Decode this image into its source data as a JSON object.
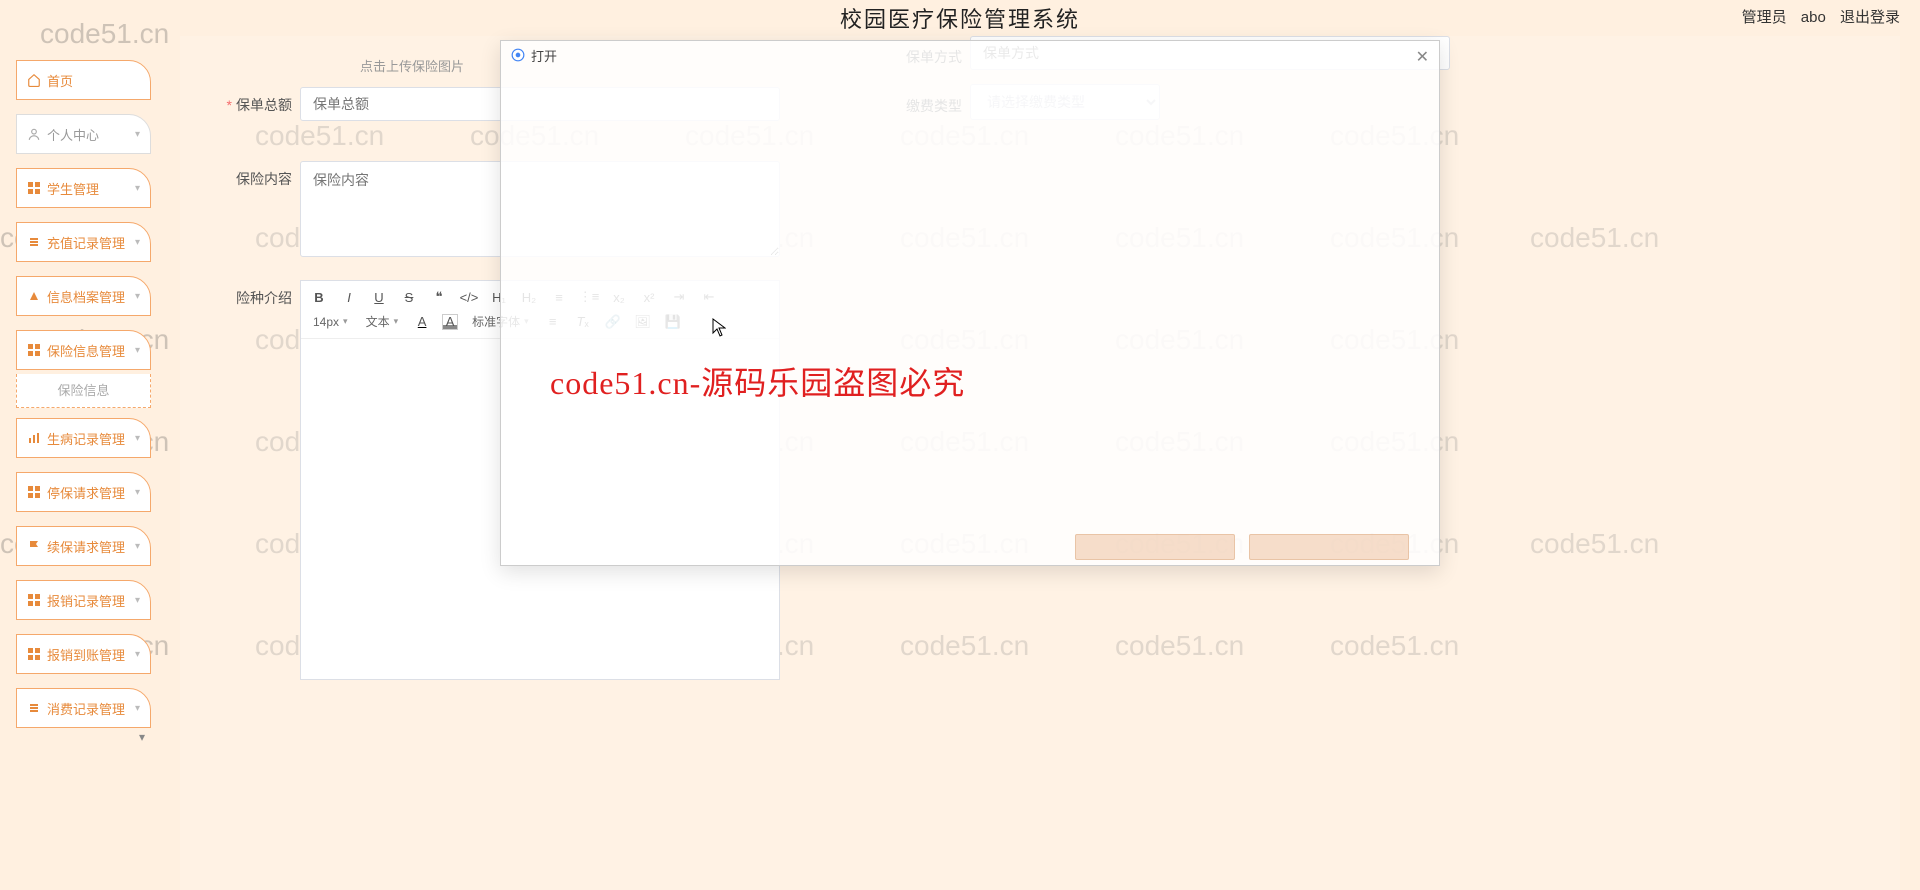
{
  "header": {
    "title": "校园医疗保险管理系统",
    "role": "管理员",
    "user": "abo",
    "logout": "退出登录"
  },
  "sidebar": {
    "items": [
      {
        "label": "首页",
        "icon": "home-icon"
      },
      {
        "label": "个人中心",
        "icon": "user-icon",
        "expandable": true
      },
      {
        "label": "学生管理",
        "icon": "grid-icon",
        "expandable": true
      },
      {
        "label": "充值记录管理",
        "icon": "list-icon",
        "expandable": true
      },
      {
        "label": "信息档案管理",
        "icon": "triangle-icon",
        "expandable": true
      },
      {
        "label": "保险信息管理",
        "icon": "grid-icon",
        "expandable": true,
        "sub": "保险信息"
      },
      {
        "label": "生病记录管理",
        "icon": "chart-icon",
        "expandable": true
      },
      {
        "label": "停保请求管理",
        "icon": "grid-icon",
        "expandable": true
      },
      {
        "label": "续保请求管理",
        "icon": "flag-icon",
        "expandable": true
      },
      {
        "label": "报销记录管理",
        "icon": "grid-icon",
        "expandable": true
      },
      {
        "label": "报销到账管理",
        "icon": "grid-icon",
        "expandable": true
      },
      {
        "label": "消费记录管理",
        "icon": "list-icon",
        "expandable": true
      }
    ]
  },
  "form": {
    "upload_hint": "点击上传保险图片",
    "amount_label": "保单总额",
    "amount_placeholder": "保单总额",
    "method_label": "保单方式",
    "method_placeholder": "保单方式",
    "paytype_label": "缴费类型",
    "paytype_placeholder": "请选择缴费类型",
    "content_label": "保险内容",
    "content_placeholder": "保险内容",
    "intro_label": "险种介绍"
  },
  "editor": {
    "fontsize": "14px",
    "textlabel": "文本",
    "fontlabel": "标准字体"
  },
  "dialog": {
    "title": "打开"
  },
  "overlay_text": "code51.cn-源码乐园盗图必究",
  "watermark_text": "code51.cn"
}
